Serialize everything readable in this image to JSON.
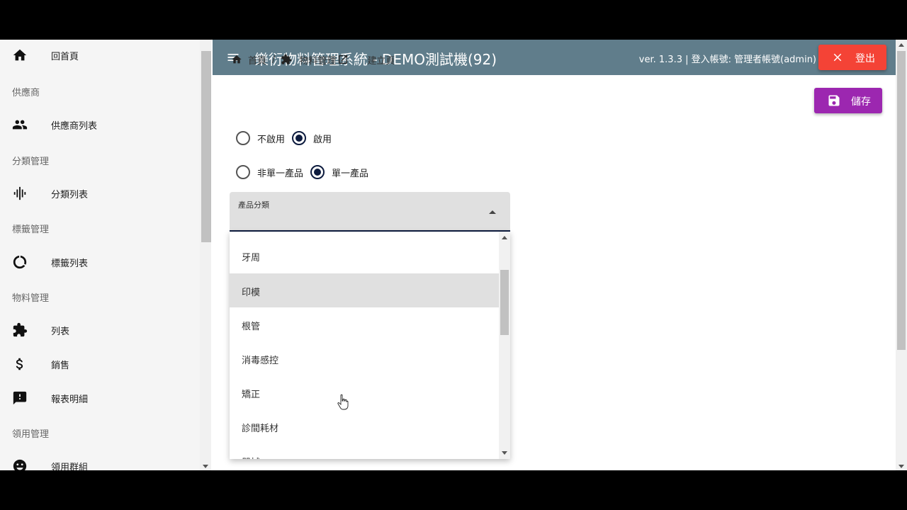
{
  "topbar": {
    "title": "樂衍物料管理系統 - DEMO測試機(92)",
    "version_text": "ver. 1.3.3 | 登入帳號: 管理者帳號(admin)",
    "logout_label": "登出"
  },
  "sidebar": {
    "home": "回首頁",
    "sec_supplier": "供應商",
    "supplier_list": "供應商列表",
    "sec_category": "分類管理",
    "category_list": "分類列表",
    "sec_tag": "標籤管理",
    "tag_list": "標籤列表",
    "sec_material": "物料管理",
    "material_list": "列表",
    "sales": "銷售",
    "report": "報表明細",
    "sec_requisition": "領用管理",
    "requisition_group": "領用群組"
  },
  "breadcrumb": {
    "home": "首頁",
    "separator": "/",
    "material": "物料管理",
    "current": "建立頁"
  },
  "save_label": "儲存",
  "status_radio": {
    "options": [
      "不啟用",
      "啟用"
    ],
    "selected": "啟用"
  },
  "product_type_radio": {
    "options": [
      "非單一產品",
      "單一產品"
    ],
    "selected": "單一產品"
  },
  "category_select": {
    "label": "產品分類",
    "options": [
      "牙周",
      "印模",
      "根管",
      "消毒感控",
      "矯正",
      "診間耗材",
      "器械"
    ],
    "highlighted": "印模"
  },
  "colors": {
    "topbar": "#607d8b",
    "logout": "#f44336",
    "save": "#9c27b0",
    "radio_selected": "#0d1b3e"
  }
}
